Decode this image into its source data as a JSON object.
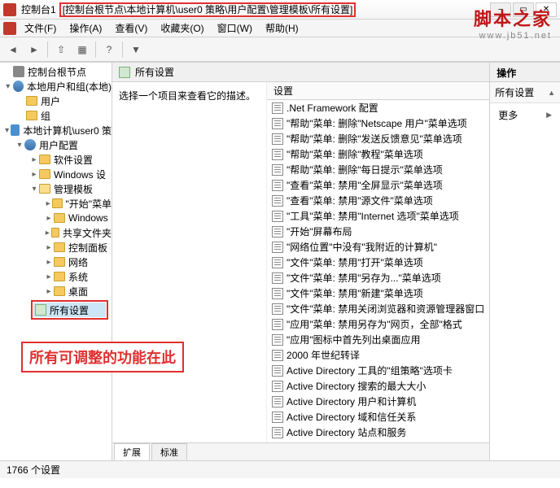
{
  "window": {
    "title": "控制台1",
    "path": "[控制台根节点\\本地计算机\\user0 策略\\用户配置\\管理模板\\所有设置]"
  },
  "menu": [
    "文件(F)",
    "操作(A)",
    "查看(V)",
    "收藏夹(O)",
    "窗口(W)",
    "帮助(H)"
  ],
  "tree": {
    "root": "控制台根节点",
    "localUsers": "本地用户和组(本地)",
    "users": "用户",
    "groups": "组",
    "policy": "本地计算机\\user0 策",
    "userConfig": "用户配置",
    "software": "软件设置",
    "windows": "Windows 设",
    "adminTpl": "管理模板",
    "startMenu": "\"开始\"菜单",
    "windowsComp": "Windows",
    "sharedFolders": "共享文件夹",
    "controlPanel": "控制面板",
    "network": "网络",
    "system": "系统",
    "desktop": "桌面",
    "allSettings": "所有设置"
  },
  "content": {
    "header": "所有设置",
    "desc": "选择一个项目来查看它的描述。",
    "listHeader": "设置",
    "items": [
      ".Net Framework 配置",
      "\"帮助\"菜单: 删除\"Netscape 用户\"菜单选项",
      "\"帮助\"菜单: 删除\"发送反馈意见\"菜单选项",
      "\"帮助\"菜单: 删除\"教程\"菜单选项",
      "\"帮助\"菜单: 删除\"每日提示\"菜单选项",
      "\"查看\"菜单: 禁用\"全屏显示\"菜单选项",
      "\"查看\"菜单: 禁用\"源文件\"菜单选项",
      "\"工具\"菜单: 禁用\"Internet 选项\"菜单选项",
      "\"开始\"屏幕布局",
      "\"网络位置\"中没有\"我附近的计算机\"",
      "\"文件\"菜单: 禁用\"打开\"菜单选项",
      "\"文件\"菜单: 禁用\"另存为...\"菜单选项",
      "\"文件\"菜单: 禁用\"新建\"菜单选项",
      "\"文件\"菜单: 禁用关闭浏览器和资源管理器窗口",
      "\"应用\"菜单: 禁用另存为\"网页，全部\"格式",
      "\"应用\"图标中首先列出桌面应用",
      "2000 年世纪转译",
      "Active Directory 工具的\"组策略\"选项卡",
      "Active Directory 搜索的最大大小",
      "Active Directory 用户和计算机",
      "Active Directory 域和信任关系",
      "Active Directory 站点和服务"
    ],
    "tabs": [
      "扩展",
      "标准"
    ]
  },
  "actions": {
    "header": "操作",
    "sub": "所有设置",
    "more": "更多"
  },
  "status": "1766 个设置",
  "annotation": "所有可调整的功能在此",
  "watermark": {
    "l1": "脚本之家",
    "l2": "www.jb51.net"
  }
}
